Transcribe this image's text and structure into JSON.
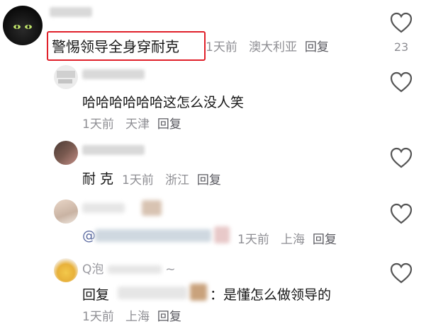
{
  "comments": [
    {
      "text": "警惕领导全身穿耐克",
      "time": "1天前",
      "location": "澳大利亚",
      "reply_label": "回复",
      "likes": "23",
      "highlighted": true
    },
    {
      "text": "哈哈哈哈哈哈这怎么没人笑",
      "time": "1天前",
      "location": "天津",
      "reply_label": "回复"
    },
    {
      "text": "耐 克",
      "time": "1天前",
      "location": "浙江",
      "reply_label": "回复"
    },
    {
      "mention_prefix": "@",
      "time": "1天前",
      "location": "上海",
      "reply_label": "回复"
    },
    {
      "name_partial": "Q泡",
      "name_tail": "~",
      "reply_prefix": "回复",
      "text": "：是懂怎么做领导的",
      "time": "1天前",
      "location": "上海",
      "reply_label": "回复"
    }
  ],
  "colors": {
    "highlight_border": "#e0202a",
    "meta_text": "#8e8e93",
    "heart_stroke": "#555555"
  },
  "icons": [
    "heart-icon"
  ]
}
